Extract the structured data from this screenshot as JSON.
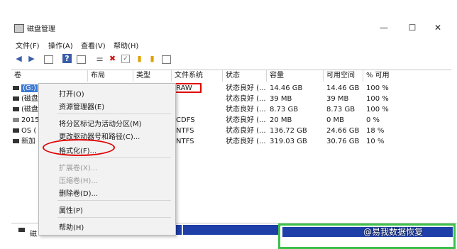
{
  "window": {
    "title": "磁盘管理",
    "controls": {
      "minimize": "—",
      "maximize": "☐",
      "close": "✕"
    }
  },
  "menubar": {
    "items": [
      {
        "label": "文件(F)"
      },
      {
        "label": "操作(A)"
      },
      {
        "label": "查看(V)"
      },
      {
        "label": "帮助(H)"
      }
    ]
  },
  "toolbar": {
    "icons": [
      "back-arrow-icon",
      "forward-arrow-icon",
      "grid-icon",
      "help-icon",
      "panel-icon",
      "connect-icon",
      "delete-x-icon",
      "check-icon",
      "folder-up-icon",
      "search-folder-icon",
      "window-icon"
    ]
  },
  "table": {
    "headers": [
      "卷",
      "布局",
      "类型",
      "文件系统",
      "状态",
      "容量",
      "可用空间",
      "% 可用"
    ],
    "rows": [
      {
        "volume": "(G:)",
        "layout": "",
        "type": "",
        "fs": "RAW",
        "status": "状态良好 (...",
        "capacity": "14.46 GB",
        "free": "14.46 GB",
        "pct": "100 %"
      },
      {
        "volume": "(磁盘",
        "layout": "",
        "type": "",
        "fs": "",
        "status": "状态良好 (...",
        "capacity": "39 MB",
        "free": "39 MB",
        "pct": "100 %"
      },
      {
        "volume": "(磁盘",
        "layout": "",
        "type": "",
        "fs": "",
        "status": "状态良好 (...",
        "capacity": "8.73 GB",
        "free": "8.73 GB",
        "pct": "100 %"
      },
      {
        "volume": "2015",
        "layout": "",
        "type": "",
        "fs": "CDFS",
        "status": "状态良好 (...",
        "capacity": "20 MB",
        "free": "0 MB",
        "pct": "0 %"
      },
      {
        "volume": "OS (",
        "layout": "",
        "type": "",
        "fs": "NTFS",
        "status": "状态良好 (...",
        "capacity": "136.72 GB",
        "free": "24.66 GB",
        "pct": "18 %"
      },
      {
        "volume": "新加",
        "layout": "",
        "type": "",
        "fs": "NTFS",
        "status": "状态良好 (...",
        "capacity": "319.03 GB",
        "free": "30.76 GB",
        "pct": "10 %"
      }
    ]
  },
  "context_menu": {
    "items": [
      {
        "label": "打开(O)",
        "enabled": true
      },
      {
        "label": "资源管理器(E)",
        "enabled": true
      },
      {
        "label": "将分区标记为活动分区(M)",
        "enabled": true
      },
      {
        "label": "更改驱动器号和路径(C)...",
        "enabled": true
      },
      {
        "label": "格式化(F)...",
        "enabled": true
      },
      {
        "label": "扩展卷(X)...",
        "enabled": false
      },
      {
        "label": "压缩卷(H)...",
        "enabled": false
      },
      {
        "label": "删除卷(D)...",
        "enabled": true
      },
      {
        "label": "属性(P)",
        "enabled": true
      },
      {
        "label": "帮助(H)",
        "enabled": true
      }
    ]
  },
  "disk_area": {
    "label": "磁"
  },
  "watermark": "@易我数据恢复",
  "colors": {
    "highlight_red": "#e00000",
    "partition_blue": "#1f3fa8",
    "selection_green": "#3cc04a"
  }
}
